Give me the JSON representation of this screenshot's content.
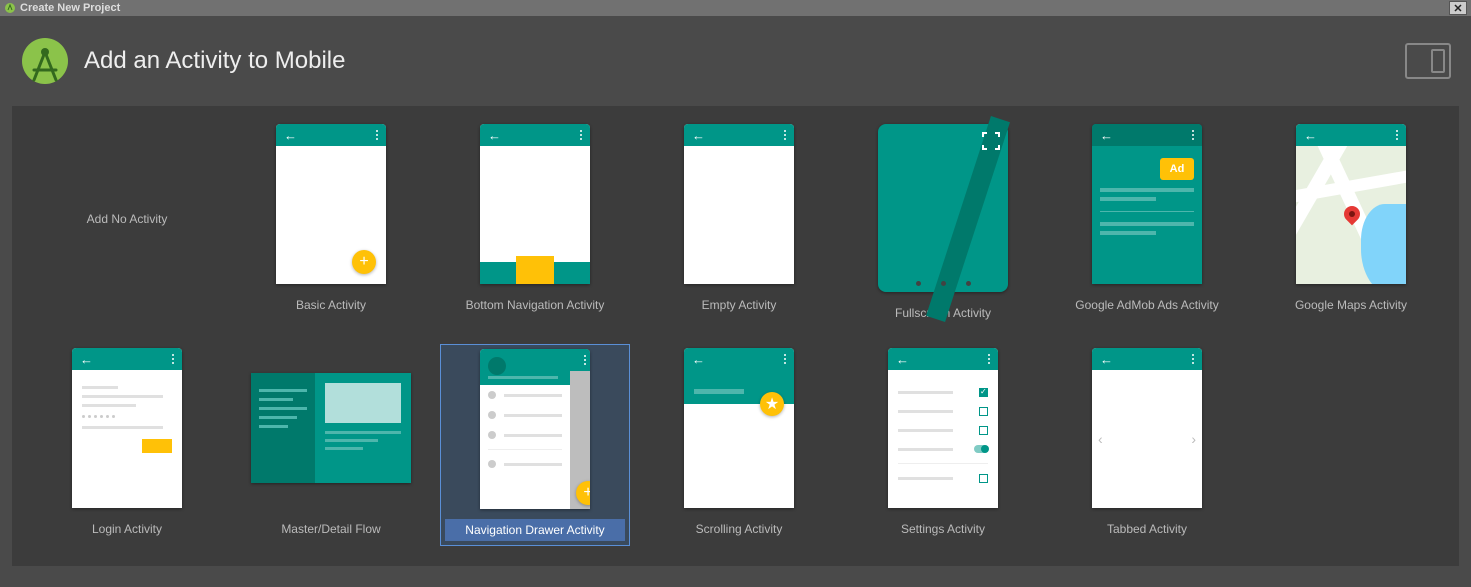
{
  "window": {
    "title": "Create New Project"
  },
  "header": {
    "title": "Add an Activity to Mobile"
  },
  "templates": [
    {
      "id": "no-activity",
      "label": "Add No Activity"
    },
    {
      "id": "basic",
      "label": "Basic Activity"
    },
    {
      "id": "bottom-nav",
      "label": "Bottom Navigation Activity"
    },
    {
      "id": "empty",
      "label": "Empty Activity"
    },
    {
      "id": "fullscreen",
      "label": "Fullscreen Activity"
    },
    {
      "id": "admob",
      "label": "Google AdMob Ads Activity"
    },
    {
      "id": "maps",
      "label": "Google Maps Activity"
    },
    {
      "id": "login",
      "label": "Login Activity"
    },
    {
      "id": "master-detail",
      "label": "Master/Detail Flow"
    },
    {
      "id": "nav-drawer",
      "label": "Navigation Drawer Activity"
    },
    {
      "id": "scrolling",
      "label": "Scrolling Activity"
    },
    {
      "id": "settings",
      "label": "Settings Activity"
    },
    {
      "id": "tabbed",
      "label": "Tabbed Activity"
    }
  ],
  "selected_template": "nav-drawer",
  "admob_badge": "Ad",
  "colors": {
    "teal": "#009688",
    "teal_dark": "#00796b",
    "amber": "#ffc107"
  }
}
